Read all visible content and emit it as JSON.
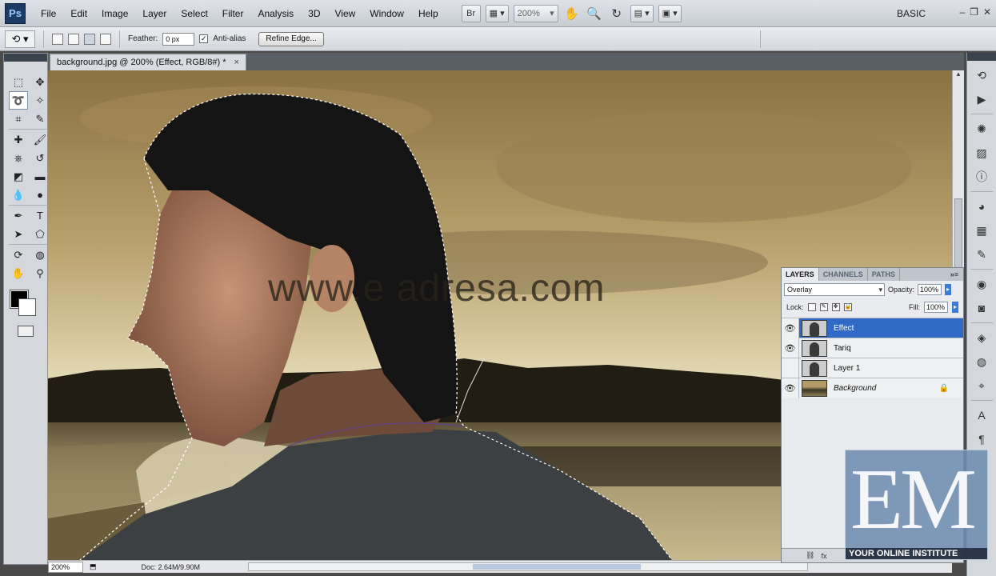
{
  "app": {
    "logo": "Ps",
    "workspace": "BASIC"
  },
  "menu": [
    "File",
    "Edit",
    "Image",
    "Layer",
    "Select",
    "Filter",
    "Analysis",
    "3D",
    "View",
    "Window",
    "Help"
  ],
  "menubar_tools": {
    "bridge_label": "Br",
    "zoom_value": "200%"
  },
  "options_bar": {
    "tool_icon": "lasso-icon",
    "feather_label": "Feather:",
    "feather_value": "0 px",
    "antialias_label": "Anti-alias",
    "antialias_checked": true,
    "refine_edge_label": "Refine Edge..."
  },
  "document": {
    "tab_title": "background.jpg @ 200% (Effect, RGB/8#) *",
    "close_glyph": "×",
    "watermark": "www.e  adresa.com",
    "zoom_field": "200%",
    "doc_info": "Doc: 2.64M/9.90M"
  },
  "layers_panel": {
    "tabs": [
      "LAYERS",
      "CHANNELS",
      "PATHS"
    ],
    "active_tab": "LAYERS",
    "blend_mode": "Overlay",
    "opacity_label": "Opacity:",
    "opacity_value": "100%",
    "lock_label": "Lock:",
    "fill_label": "Fill:",
    "fill_value": "100%",
    "layers": [
      {
        "name": "Effect",
        "visible": true,
        "selected": true,
        "thumb": "person"
      },
      {
        "name": "Tariq",
        "visible": true,
        "selected": false,
        "thumb": "person"
      },
      {
        "name": "Layer 1",
        "visible": false,
        "selected": false,
        "thumb": "person"
      },
      {
        "name": "Background",
        "visible": true,
        "selected": false,
        "thumb": "landscape",
        "locked": true
      }
    ]
  },
  "overlay_logo": {
    "letters": "EM",
    "tagline": "YOUR ONLINE INSTITUTE"
  }
}
